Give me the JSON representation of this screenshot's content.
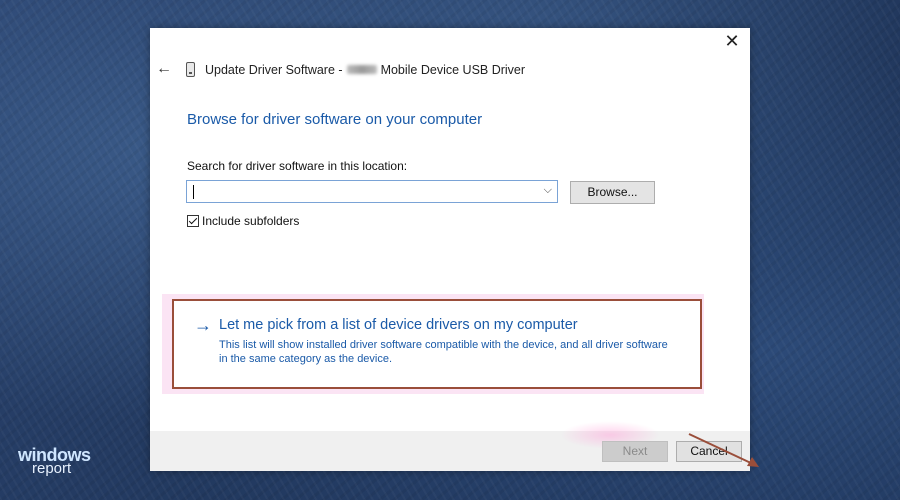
{
  "dialog": {
    "title_prefix": "Update Driver Software - ",
    "title_suffix": "Mobile Device USB Driver",
    "close_glyph": "✕",
    "back_glyph": "←",
    "heading": "Browse for driver software on your computer",
    "search_label": "Search for driver software in this location:",
    "path_value": "",
    "dropdown_glyph": "⌵",
    "browse_label": "Browse...",
    "include_subfolders": {
      "label": "Include subfolders",
      "checked": true
    },
    "pick_option": {
      "arrow_glyph": "→",
      "title": "Let me pick from a list of device drivers on my computer",
      "description": "This list will show installed driver software compatible with the device, and all driver software in the same category as the device."
    },
    "footer": {
      "next_label": "Next",
      "next_enabled": false,
      "cancel_label": "Cancel"
    }
  },
  "watermark": {
    "line1": "windows",
    "line2": "report"
  },
  "colors": {
    "link_blue": "#1a5aa8",
    "annotation_border": "#9a4e3a",
    "highlight_pink": "#fbe4f4",
    "desktop_bg": "#2b4470"
  }
}
